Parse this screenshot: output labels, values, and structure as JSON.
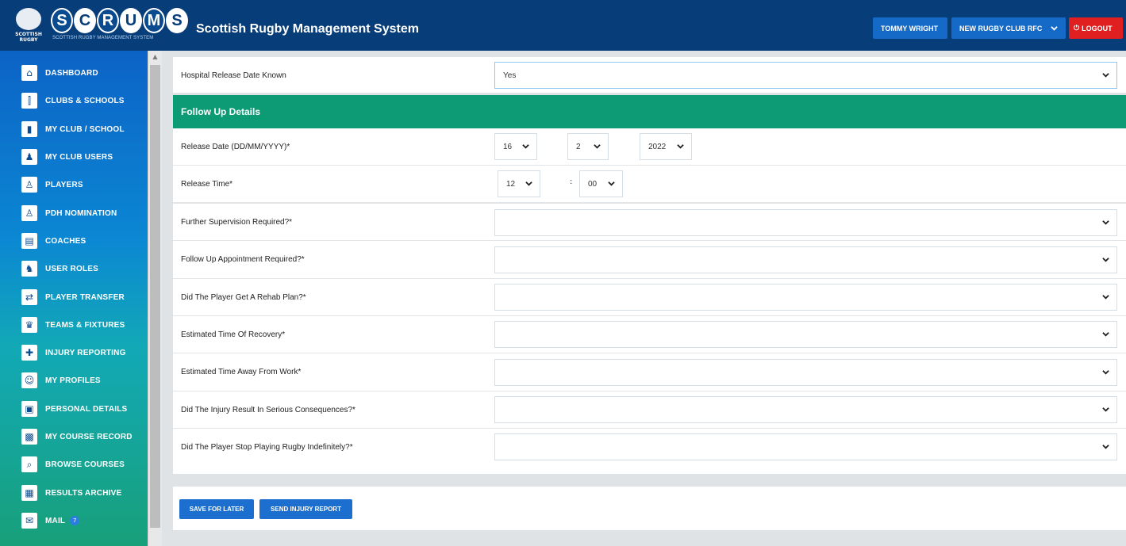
{
  "header": {
    "crest_text": "SCOTTISH RUGBY",
    "logo_letters": [
      "S",
      "C",
      "R",
      "U",
      "M",
      "S"
    ],
    "logo_subtitle": "SCOTTISH RUGBY MANAGEMENT SYSTEM",
    "app_title": "Scottish Rugby Management System",
    "user_button": "TOMMY WRIGHT",
    "club_selector": "NEW RUGBY CLUB RFC",
    "logout_button": "LOGOUT",
    "colors": {
      "header_bg": "#073d78",
      "button_blue": "#1569c7",
      "logout_red": "#e02020"
    }
  },
  "sidebar": {
    "items": [
      {
        "label": "DASHBOARD",
        "icon": "dashboard-icon"
      },
      {
        "label": "CLUBS & SCHOOLS",
        "icon": "clubs-icon"
      },
      {
        "label": "MY CLUB / SCHOOL",
        "icon": "club-icon"
      },
      {
        "label": "MY CLUB USERS",
        "icon": "users-icon"
      },
      {
        "label": "PLAYERS",
        "icon": "player-icon"
      },
      {
        "label": "PDH NOMINATION",
        "icon": "nomination-icon"
      },
      {
        "label": "COACHES",
        "icon": "clipboard-icon"
      },
      {
        "label": "USER ROLES",
        "icon": "roles-icon"
      },
      {
        "label": "PLAYER TRANSFER",
        "icon": "transfer-icon"
      },
      {
        "label": "TEAMS & FIXTURES",
        "icon": "trophy-icon"
      },
      {
        "label": "INJURY REPORTING",
        "icon": "ambulance-icon"
      },
      {
        "label": "MY PROFILES",
        "icon": "profile-icon"
      },
      {
        "label": "PERSONAL DETAILS",
        "icon": "details-icon"
      },
      {
        "label": "MY COURSE RECORD",
        "icon": "course-record-icon"
      },
      {
        "label": "BROWSE COURSES",
        "icon": "browse-icon"
      },
      {
        "label": "RESULTS ARCHIVE",
        "icon": "archive-icon"
      },
      {
        "label": "MAIL",
        "icon": "mail-icon",
        "badge": "7"
      }
    ]
  },
  "form": {
    "hospital_release": {
      "label": "Hospital Release Date Known",
      "value": "Yes"
    },
    "section_title": "Follow Up Details",
    "release_date": {
      "label": "Release Date (DD/MM/YYYY)*",
      "day": "16",
      "month": "2",
      "year": "2022"
    },
    "release_time": {
      "label": "Release Time*",
      "hour": "12",
      "separator": ":",
      "minute": "00"
    },
    "fields": [
      {
        "label": "Further Supervision Required?*",
        "value": ""
      },
      {
        "label": "Follow Up Appointment Required?*",
        "value": ""
      },
      {
        "label": "Did The Player Get A Rehab Plan?*",
        "value": ""
      },
      {
        "label": "Estimated Time Of Recovery*",
        "value": ""
      },
      {
        "label": "Estimated Time Away From Work*",
        "value": ""
      },
      {
        "label": "Did The Injury Result In Serious Consequences?*",
        "value": ""
      },
      {
        "label": "Did The Player Stop Playing Rugby Indefinitely?*",
        "value": ""
      }
    ]
  },
  "actions": {
    "save_for_later": "SAVE FOR LATER",
    "send_report": "SEND INJURY REPORT"
  }
}
